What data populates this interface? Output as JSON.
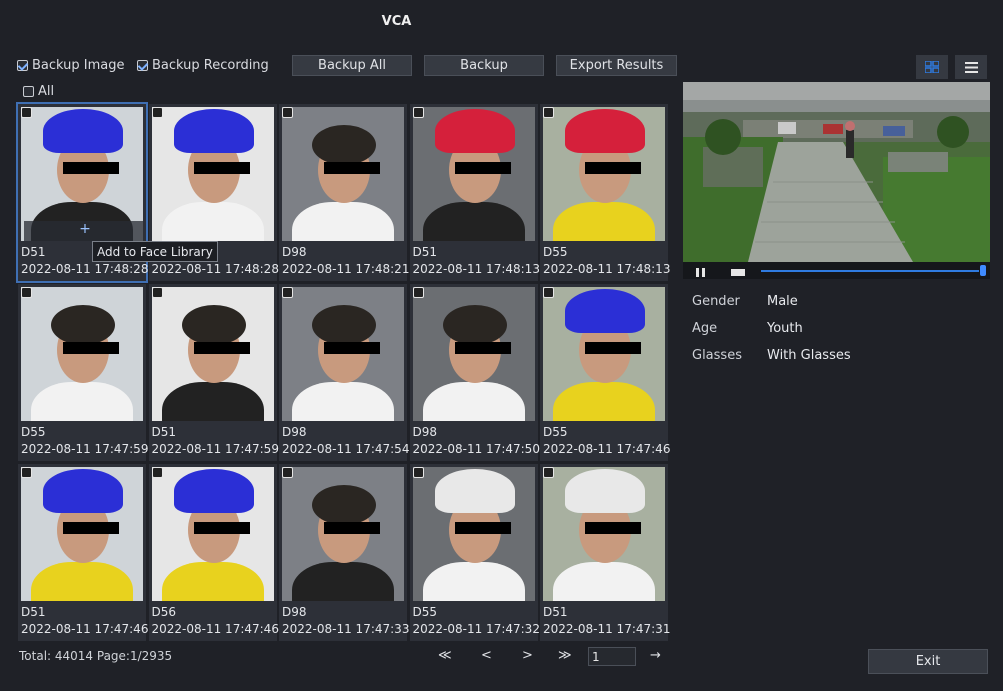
{
  "window": {
    "title": "VCA"
  },
  "toolbar": {
    "backup_image_label": "Backup Image",
    "backup_image_checked": true,
    "backup_recording_label": "Backup Recording",
    "backup_recording_checked": true,
    "backup_all_label": "Backup All",
    "backup_label": "Backup",
    "export_label": "Export Results",
    "all_label": "All"
  },
  "colors": {
    "accent": "#2f7be0",
    "selected_border": "#3f6fb3",
    "background": "#1f2127"
  },
  "results": [
    {
      "camera": "D51",
      "time": "2022-08-11 17:48:28",
      "selected": true,
      "hat": "blue"
    },
    {
      "camera": "D51",
      "time": "2022-08-11 17:48:28",
      "selected": false,
      "hat": "blue"
    },
    {
      "camera": "D98",
      "time": "2022-08-11 17:48:21",
      "selected": false,
      "hat": "none"
    },
    {
      "camera": "D51",
      "time": "2022-08-11 17:48:13",
      "selected": false,
      "hat": "red"
    },
    {
      "camera": "D55",
      "time": "2022-08-11 17:48:13",
      "selected": false,
      "hat": "red"
    },
    {
      "camera": "D55",
      "time": "2022-08-11 17:47:59",
      "selected": false,
      "hat": "none"
    },
    {
      "camera": "D51",
      "time": "2022-08-11 17:47:59",
      "selected": false,
      "hat": "none"
    },
    {
      "camera": "D98",
      "time": "2022-08-11 17:47:54",
      "selected": false,
      "hat": "none"
    },
    {
      "camera": "D98",
      "time": "2022-08-11 17:47:50",
      "selected": false,
      "hat": "none"
    },
    {
      "camera": "D55",
      "time": "2022-08-11 17:47:46",
      "selected": false,
      "hat": "blue"
    },
    {
      "camera": "D51",
      "time": "2022-08-11 17:47:46",
      "selected": false,
      "hat": "blue"
    },
    {
      "camera": "D56",
      "time": "2022-08-11 17:47:46",
      "selected": false,
      "hat": "blue"
    },
    {
      "camera": "D98",
      "time": "2022-08-11 17:47:33",
      "selected": false,
      "hat": "none"
    },
    {
      "camera": "D55",
      "time": "2022-08-11 17:47:32",
      "selected": false,
      "hat": "white"
    },
    {
      "camera": "D51",
      "time": "2022-08-11 17:47:31",
      "selected": false,
      "hat": "white"
    }
  ],
  "tooltip": {
    "add_face_library": "Add to Face Library"
  },
  "attributes": [
    {
      "label": "Gender",
      "value": "Male"
    },
    {
      "label": "Age",
      "value": "Youth"
    },
    {
      "label": "Glasses",
      "value": "With Glasses"
    }
  ],
  "playback": {
    "progress": 1.0
  },
  "pagination": {
    "summary": "Total: 44014  Page:1/2935",
    "first": "≪",
    "prev": "<",
    "next": ">",
    "last": "≫",
    "page_input": "1",
    "go": "→"
  },
  "exit_label": "Exit"
}
